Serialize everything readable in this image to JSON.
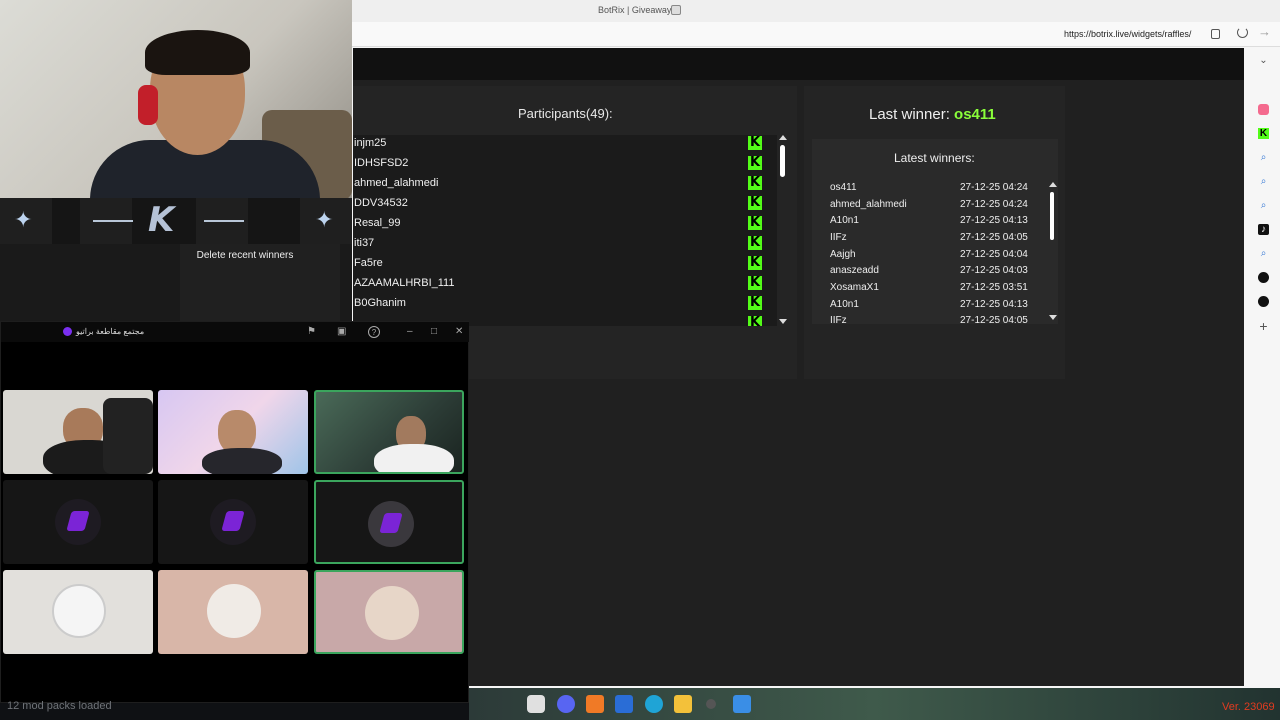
{
  "browser": {
    "tab_title": "BotRix | Giveaways",
    "url": "https://botrix.live/widgets/raffles/"
  },
  "participants": {
    "title": "Participants(49):",
    "items": [
      "injm25",
      "IDHSFSD2",
      "ahmed_alahmedi",
      "DDV34532",
      "Resal_99",
      "iti37",
      "Fa5re",
      "AZAAMALHRBI_111",
      "B0Ghanim"
    ],
    "platform_icon": "kick-icon",
    "platform_glyph": "K",
    "platform_color": "#53fc18"
  },
  "winners": {
    "last_winner_label": "Last winner:",
    "last_winner_name": "os411",
    "latest_title": "Latest winners:",
    "rows": [
      {
        "name": "os411",
        "time": "27-12-25 04:24"
      },
      {
        "name": "ahmed_alahmedi",
        "time": "27-12-25 04:24"
      },
      {
        "name": "A10n1",
        "time": "27-12-25 04:13"
      },
      {
        "name": "IIFz",
        "time": "27-12-25 04:05"
      },
      {
        "name": "Aajgh",
        "time": "27-12-25 04:04"
      },
      {
        "name": "anaszeadd",
        "time": "27-12-25 04:03"
      },
      {
        "name": "XosamaX1",
        "time": "27-12-25 03:51"
      },
      {
        "name": "A10n1",
        "time": "27-12-25 04:13"
      },
      {
        "name": "IIFz",
        "time": "27-12-25 04:05"
      }
    ]
  },
  "overlay": {
    "delete_label": "Delete recent winners"
  },
  "call": {
    "title": "مجتمع مقاطعة براتيو"
  },
  "status": {
    "mod_packs": "12 mod packs loaded",
    "version": "Ver. 23069"
  },
  "colors": {
    "accent_green": "#53fc18",
    "winner_green": "#8aff3a",
    "speaking_border": "#3ba55d",
    "version_red": "#e23b20"
  }
}
